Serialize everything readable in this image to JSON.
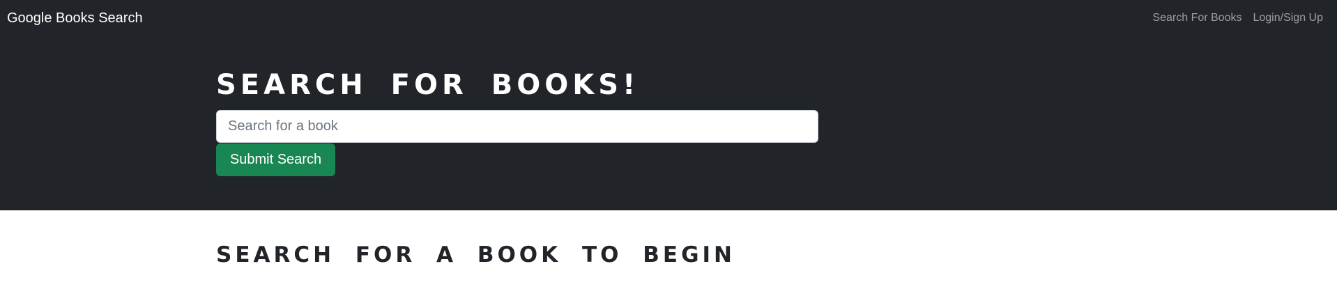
{
  "navbar": {
    "brand": "Google Books Search",
    "links": [
      {
        "label": "Search For Books"
      },
      {
        "label": "Login/Sign Up"
      }
    ]
  },
  "hero": {
    "title": "SEARCH FOR BOOKS!",
    "search": {
      "placeholder": "Search for a book",
      "value": ""
    },
    "submit_label": "Submit Search"
  },
  "results": {
    "heading": "SEARCH FOR A BOOK TO BEGIN"
  },
  "colors": {
    "dark_bg": "#212529",
    "submit_green": "#198754",
    "nav_link": "rgba(255,255,255,0.55)"
  }
}
